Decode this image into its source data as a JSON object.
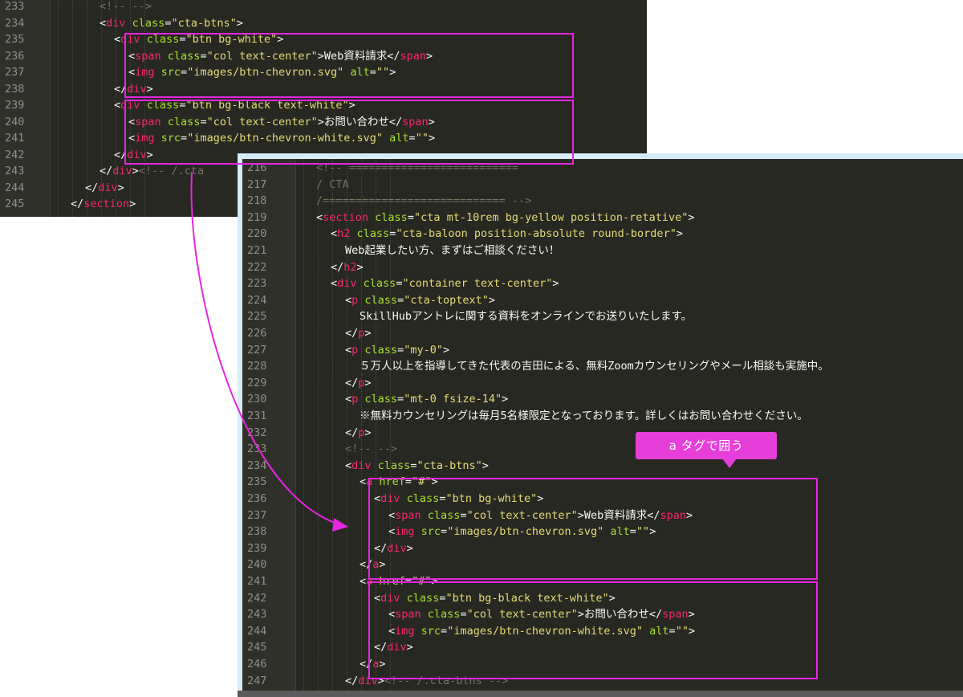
{
  "colors": {
    "editor_bg": "#272822",
    "tag": "#f92672",
    "attr": "#a6e22e",
    "string": "#e6db74",
    "comment": "#75715e",
    "text": "#f8f8f2",
    "highlight": "#e626e0"
  },
  "callout": {
    "label": "a タグで囲う"
  },
  "before_editor": {
    "lines": [
      {
        "num": "233",
        "segs": [
          {
            "c": "c",
            "t": "<!-- -->"
          }
        ],
        "indent": 3
      },
      {
        "num": "234",
        "segs": [
          {
            "c": "w",
            "t": "<"
          },
          {
            "c": "t",
            "t": "div"
          },
          {
            "c": "a",
            "t": " class"
          },
          {
            "c": "w",
            "t": "="
          },
          {
            "c": "s",
            "t": "\"cta-btns\""
          },
          {
            "c": "w",
            "t": ">"
          }
        ],
        "indent": 3
      },
      {
        "num": "235",
        "segs": [
          {
            "c": "w",
            "t": "<"
          },
          {
            "c": "t",
            "t": "div"
          },
          {
            "c": "a",
            "t": " class"
          },
          {
            "c": "w",
            "t": "="
          },
          {
            "c": "s",
            "t": "\"btn bg-white\""
          },
          {
            "c": "w",
            "t": ">"
          }
        ],
        "indent": 4
      },
      {
        "num": "236",
        "segs": [
          {
            "c": "w",
            "t": "<"
          },
          {
            "c": "t",
            "t": "span"
          },
          {
            "c": "a",
            "t": " class"
          },
          {
            "c": "w",
            "t": "="
          },
          {
            "c": "s",
            "t": "\"col text-center\""
          },
          {
            "c": "w",
            "t": ">Web資料請求</"
          },
          {
            "c": "t",
            "t": "span"
          },
          {
            "c": "w",
            "t": ">"
          }
        ],
        "indent": 5
      },
      {
        "num": "237",
        "segs": [
          {
            "c": "w",
            "t": "<"
          },
          {
            "c": "t",
            "t": "img"
          },
          {
            "c": "a",
            "t": " src"
          },
          {
            "c": "w",
            "t": "="
          },
          {
            "c": "s",
            "t": "\"images/btn-chevron.svg\""
          },
          {
            "c": "a",
            "t": " alt"
          },
          {
            "c": "w",
            "t": "="
          },
          {
            "c": "s",
            "t": "\"\""
          },
          {
            "c": "w",
            "t": ">"
          }
        ],
        "indent": 5
      },
      {
        "num": "238",
        "segs": [
          {
            "c": "w",
            "t": "</"
          },
          {
            "c": "t",
            "t": "div"
          },
          {
            "c": "w",
            "t": ">"
          }
        ],
        "indent": 4
      },
      {
        "num": "239",
        "segs": [
          {
            "c": "w",
            "t": "<"
          },
          {
            "c": "t",
            "t": "div"
          },
          {
            "c": "a",
            "t": " class"
          },
          {
            "c": "w",
            "t": "="
          },
          {
            "c": "s",
            "t": "\"btn bg-black text-white\""
          },
          {
            "c": "w",
            "t": ">"
          }
        ],
        "indent": 4
      },
      {
        "num": "240",
        "segs": [
          {
            "c": "w",
            "t": "<"
          },
          {
            "c": "t",
            "t": "span"
          },
          {
            "c": "a",
            "t": " class"
          },
          {
            "c": "w",
            "t": "="
          },
          {
            "c": "s",
            "t": "\"col text-center\""
          },
          {
            "c": "w",
            "t": ">お問い合わせ</"
          },
          {
            "c": "t",
            "t": "span"
          },
          {
            "c": "w",
            "t": ">"
          }
        ],
        "indent": 5
      },
      {
        "num": "241",
        "segs": [
          {
            "c": "w",
            "t": "<"
          },
          {
            "c": "t",
            "t": "img"
          },
          {
            "c": "a",
            "t": " src"
          },
          {
            "c": "w",
            "t": "="
          },
          {
            "c": "s",
            "t": "\"images/btn-chevron-white.svg\""
          },
          {
            "c": "a",
            "t": " alt"
          },
          {
            "c": "w",
            "t": "="
          },
          {
            "c": "s",
            "t": "\"\""
          },
          {
            "c": "w",
            "t": ">"
          }
        ],
        "indent": 5
      },
      {
        "num": "242",
        "segs": [
          {
            "c": "w",
            "t": "</"
          },
          {
            "c": "t",
            "t": "div"
          },
          {
            "c": "w",
            "t": ">"
          }
        ],
        "indent": 4
      },
      {
        "num": "243",
        "segs": [
          {
            "c": "w",
            "t": "</"
          },
          {
            "c": "t",
            "t": "div"
          },
          {
            "c": "w",
            "t": ">"
          },
          {
            "c": "c",
            "t": "<!-- /.cta"
          }
        ],
        "indent": 3
      },
      {
        "num": "244",
        "segs": [
          {
            "c": "w",
            "t": "</"
          },
          {
            "c": "t",
            "t": "div"
          },
          {
            "c": "w",
            "t": ">"
          }
        ],
        "indent": 2
      },
      {
        "num": "245",
        "segs": [
          {
            "c": "w",
            "t": "</"
          },
          {
            "c": "t",
            "t": "section"
          },
          {
            "c": "w",
            "t": ">"
          }
        ],
        "indent": 1
      }
    ]
  },
  "after_editor": {
    "lines": [
      {
        "num": "216",
        "segs": [
          {
            "c": "c",
            "t": "<!-- =========================="
          }
        ],
        "indent": 1
      },
      {
        "num": "217",
        "segs": [
          {
            "c": "c",
            "t": "/ CTA"
          }
        ],
        "indent": 1
      },
      {
        "num": "218",
        "segs": [
          {
            "c": "c",
            "t": "/============================ -->"
          }
        ],
        "indent": 1
      },
      {
        "num": "219",
        "segs": [
          {
            "c": "w",
            "t": "<"
          },
          {
            "c": "t",
            "t": "section"
          },
          {
            "c": "a",
            "t": " class"
          },
          {
            "c": "w",
            "t": "="
          },
          {
            "c": "s",
            "t": "\"cta mt-10rem bg-yellow position-retative\""
          },
          {
            "c": "w",
            "t": ">"
          }
        ],
        "indent": 1
      },
      {
        "num": "220",
        "segs": [
          {
            "c": "w",
            "t": "<"
          },
          {
            "c": "t",
            "t": "h2"
          },
          {
            "c": "a",
            "t": " class"
          },
          {
            "c": "w",
            "t": "="
          },
          {
            "c": "s",
            "t": "\"cta-baloon position-absolute round-border\""
          },
          {
            "c": "w",
            "t": ">"
          }
        ],
        "indent": 2
      },
      {
        "num": "221",
        "segs": [
          {
            "c": "w",
            "t": "Web起業したい方、まずはご相談ください！"
          }
        ],
        "indent": 3
      },
      {
        "num": "222",
        "segs": [
          {
            "c": "w",
            "t": "</"
          },
          {
            "c": "t",
            "t": "h2"
          },
          {
            "c": "w",
            "t": ">"
          }
        ],
        "indent": 2
      },
      {
        "num": "223",
        "segs": [
          {
            "c": "w",
            "t": "<"
          },
          {
            "c": "t",
            "t": "div"
          },
          {
            "c": "a",
            "t": " class"
          },
          {
            "c": "w",
            "t": "="
          },
          {
            "c": "s",
            "t": "\"container text-center\""
          },
          {
            "c": "w",
            "t": ">"
          }
        ],
        "indent": 2
      },
      {
        "num": "224",
        "segs": [
          {
            "c": "w",
            "t": "<"
          },
          {
            "c": "t",
            "t": "p"
          },
          {
            "c": "a",
            "t": " class"
          },
          {
            "c": "w",
            "t": "="
          },
          {
            "c": "s",
            "t": "\"cta-toptext\""
          },
          {
            "c": "w",
            "t": ">"
          }
        ],
        "indent": 3
      },
      {
        "num": "225",
        "segs": [
          {
            "c": "w",
            "t": "SkillHubアントレに関する資料をオンラインでお送りいたします。"
          }
        ],
        "indent": 4
      },
      {
        "num": "226",
        "segs": [
          {
            "c": "w",
            "t": "</"
          },
          {
            "c": "t",
            "t": "p"
          },
          {
            "c": "w",
            "t": ">"
          }
        ],
        "indent": 3
      },
      {
        "num": "227",
        "segs": [
          {
            "c": "w",
            "t": "<"
          },
          {
            "c": "t",
            "t": "p"
          },
          {
            "c": "a",
            "t": " class"
          },
          {
            "c": "w",
            "t": "="
          },
          {
            "c": "s",
            "t": "\"my-0\""
          },
          {
            "c": "w",
            "t": ">"
          }
        ],
        "indent": 3
      },
      {
        "num": "228",
        "segs": [
          {
            "c": "w",
            "t": "５万人以上を指導してきた代表の吉田による、無料Zoomカウンセリングやメール相談も実施中。"
          }
        ],
        "indent": 4
      },
      {
        "num": "229",
        "segs": [
          {
            "c": "w",
            "t": "</"
          },
          {
            "c": "t",
            "t": "p"
          },
          {
            "c": "w",
            "t": ">"
          }
        ],
        "indent": 3
      },
      {
        "num": "230",
        "segs": [
          {
            "c": "w",
            "t": "<"
          },
          {
            "c": "t",
            "t": "p"
          },
          {
            "c": "a",
            "t": " class"
          },
          {
            "c": "w",
            "t": "="
          },
          {
            "c": "s",
            "t": "\"mt-0 fsize-14\""
          },
          {
            "c": "w",
            "t": ">"
          }
        ],
        "indent": 3
      },
      {
        "num": "231",
        "segs": [
          {
            "c": "w",
            "t": "※無料カウンセリングは毎月5名様限定となっております。詳しくはお問い合わせください。"
          }
        ],
        "indent": 4
      },
      {
        "num": "232",
        "segs": [
          {
            "c": "w",
            "t": "</"
          },
          {
            "c": "t",
            "t": "p"
          },
          {
            "c": "w",
            "t": ">"
          }
        ],
        "indent": 3
      },
      {
        "num": "233",
        "segs": [
          {
            "c": "c",
            "t": "<!-- -->"
          }
        ],
        "indent": 3
      },
      {
        "num": "234",
        "segs": [
          {
            "c": "w",
            "t": "<"
          },
          {
            "c": "t",
            "t": "div"
          },
          {
            "c": "a",
            "t": " class"
          },
          {
            "c": "w",
            "t": "="
          },
          {
            "c": "s",
            "t": "\"cta-btns\""
          },
          {
            "c": "w",
            "t": ">"
          }
        ],
        "indent": 3
      },
      {
        "num": "235",
        "segs": [
          {
            "c": "w",
            "t": "<"
          },
          {
            "c": "t",
            "t": "a"
          },
          {
            "c": "a",
            "t": " href"
          },
          {
            "c": "w",
            "t": "="
          },
          {
            "c": "s",
            "t": "\"#\""
          },
          {
            "c": "w",
            "t": ">"
          }
        ],
        "indent": 4
      },
      {
        "num": "236",
        "segs": [
          {
            "c": "w",
            "t": "<"
          },
          {
            "c": "t",
            "t": "div"
          },
          {
            "c": "a",
            "t": " class"
          },
          {
            "c": "w",
            "t": "="
          },
          {
            "c": "s",
            "t": "\"btn bg-white\""
          },
          {
            "c": "w",
            "t": ">"
          }
        ],
        "indent": 5
      },
      {
        "num": "237",
        "segs": [
          {
            "c": "w",
            "t": "<"
          },
          {
            "c": "t",
            "t": "span"
          },
          {
            "c": "a",
            "t": " class"
          },
          {
            "c": "w",
            "t": "="
          },
          {
            "c": "s",
            "t": "\"col text-center\""
          },
          {
            "c": "w",
            "t": ">Web資料請求</"
          },
          {
            "c": "t",
            "t": "span"
          },
          {
            "c": "w",
            "t": ">"
          }
        ],
        "indent": 6
      },
      {
        "num": "238",
        "segs": [
          {
            "c": "w",
            "t": "<"
          },
          {
            "c": "t",
            "t": "img"
          },
          {
            "c": "a",
            "t": " src"
          },
          {
            "c": "w",
            "t": "="
          },
          {
            "c": "s",
            "t": "\"images/btn-chevron.svg\""
          },
          {
            "c": "a",
            "t": " alt"
          },
          {
            "c": "w",
            "t": "="
          },
          {
            "c": "s",
            "t": "\"\""
          },
          {
            "c": "w",
            "t": ">"
          }
        ],
        "indent": 6
      },
      {
        "num": "239",
        "segs": [
          {
            "c": "w",
            "t": "</"
          },
          {
            "c": "t",
            "t": "div"
          },
          {
            "c": "w",
            "t": ">"
          }
        ],
        "indent": 5
      },
      {
        "num": "240",
        "segs": [
          {
            "c": "w",
            "t": "</"
          },
          {
            "c": "t",
            "t": "a"
          },
          {
            "c": "w",
            "t": ">"
          }
        ],
        "indent": 4
      },
      {
        "num": "241",
        "segs": [
          {
            "c": "w",
            "t": "<"
          },
          {
            "c": "t",
            "t": "a"
          },
          {
            "c": "a",
            "t": " href"
          },
          {
            "c": "w",
            "t": "="
          },
          {
            "c": "s",
            "t": "\"#\""
          },
          {
            "c": "w",
            "t": ">"
          }
        ],
        "indent": 4
      },
      {
        "num": "242",
        "segs": [
          {
            "c": "w",
            "t": "<"
          },
          {
            "c": "t",
            "t": "div"
          },
          {
            "c": "a",
            "t": " class"
          },
          {
            "c": "w",
            "t": "="
          },
          {
            "c": "s",
            "t": "\"btn bg-black text-white\""
          },
          {
            "c": "w",
            "t": ">"
          }
        ],
        "indent": 5
      },
      {
        "num": "243",
        "segs": [
          {
            "c": "w",
            "t": "<"
          },
          {
            "c": "t",
            "t": "span"
          },
          {
            "c": "a",
            "t": " class"
          },
          {
            "c": "w",
            "t": "="
          },
          {
            "c": "s",
            "t": "\"col text-center\""
          },
          {
            "c": "w",
            "t": ">お問い合わせ</"
          },
          {
            "c": "t",
            "t": "span"
          },
          {
            "c": "w",
            "t": ">"
          }
        ],
        "indent": 6
      },
      {
        "num": "244",
        "segs": [
          {
            "c": "w",
            "t": "<"
          },
          {
            "c": "t",
            "t": "img"
          },
          {
            "c": "a",
            "t": " src"
          },
          {
            "c": "w",
            "t": "="
          },
          {
            "c": "s",
            "t": "\"images/btn-chevron-white.svg\""
          },
          {
            "c": "a",
            "t": " alt"
          },
          {
            "c": "w",
            "t": "="
          },
          {
            "c": "s",
            "t": "\"\""
          },
          {
            "c": "w",
            "t": ">"
          }
        ],
        "indent": 6
      },
      {
        "num": "245",
        "segs": [
          {
            "c": "w",
            "t": "</"
          },
          {
            "c": "t",
            "t": "div"
          },
          {
            "c": "w",
            "t": ">"
          }
        ],
        "indent": 5
      },
      {
        "num": "246",
        "segs": [
          {
            "c": "w",
            "t": "</"
          },
          {
            "c": "t",
            "t": "a"
          },
          {
            "c": "w",
            "t": ">"
          }
        ],
        "indent": 4
      },
      {
        "num": "247",
        "segs": [
          {
            "c": "w",
            "t": "</"
          },
          {
            "c": "t",
            "t": "div"
          },
          {
            "c": "w",
            "t": ">"
          },
          {
            "c": "c",
            "t": "<!-- /.cta-btns -->"
          }
        ],
        "indent": 3
      }
    ]
  }
}
